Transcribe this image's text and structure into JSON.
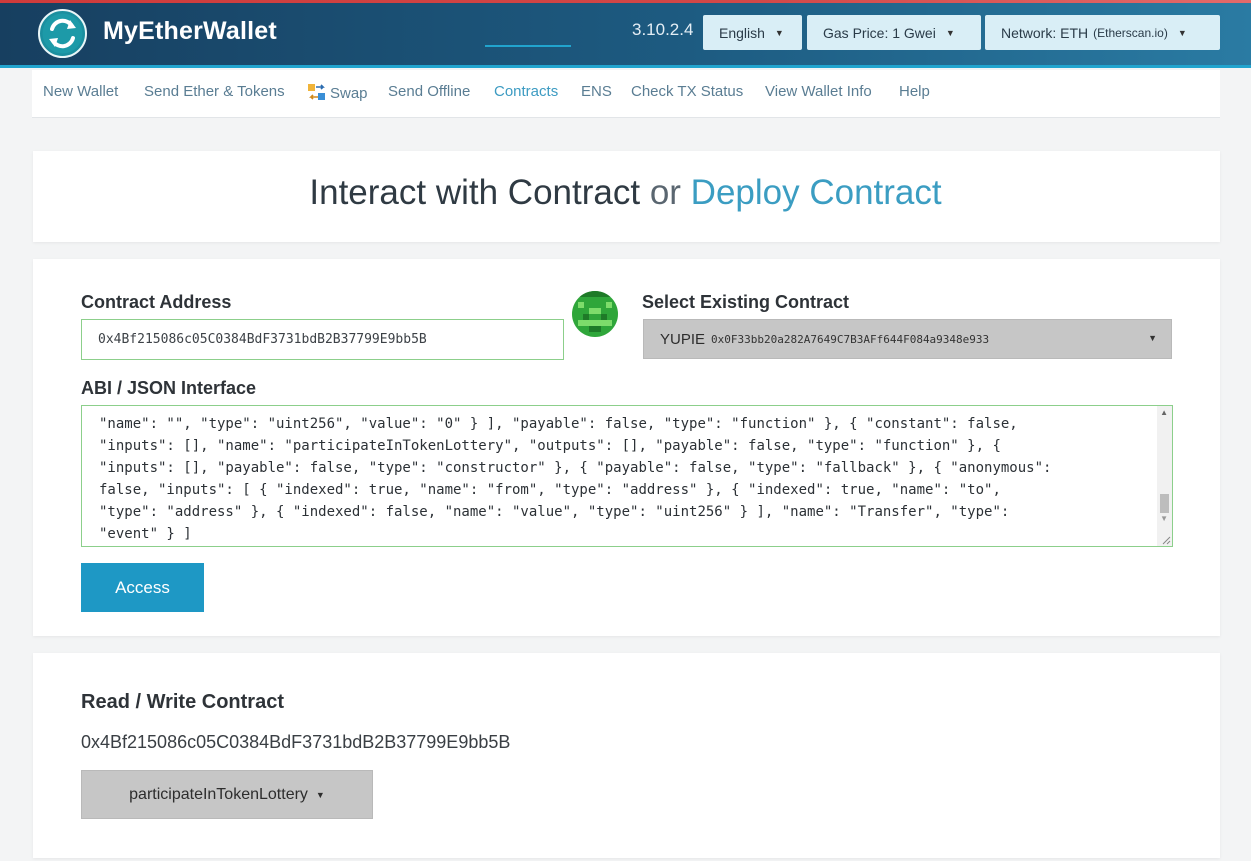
{
  "header": {
    "logo_text": "MyEtherWallet",
    "version": "3.10.2.4",
    "language": "English",
    "gas_price": "Gas Price: 1 Gwei",
    "network_label": "Network: ETH",
    "network_provider": "(Etherscan.io)"
  },
  "nav": {
    "items": [
      {
        "label": "New Wallet"
      },
      {
        "label": "Send Ether & Tokens"
      },
      {
        "label": "Swap"
      },
      {
        "label": "Send Offline"
      },
      {
        "label": "Contracts"
      },
      {
        "label": "ENS"
      },
      {
        "label": "Check TX Status"
      },
      {
        "label": "View Wallet Info"
      },
      {
        "label": "Help"
      }
    ],
    "active": "Contracts"
  },
  "title": {
    "interact": "Interact with Contract",
    "or": "or",
    "deploy": "Deploy Contract"
  },
  "form": {
    "contract_address_label": "Contract Address",
    "contract_address_value": "0x4Bf215086c05C0384BdF3731bdB2B37799E9bb5B",
    "select_label": "Select Existing Contract",
    "selected_name": "YUPIE",
    "selected_address": "0x0F33bb20a282A7649C7B3AFf644F084a9348e933",
    "abi_label": "ABI / JSON Interface",
    "abi_lines": [
      "\"name\": \"\", \"type\": \"uint256\", \"value\": \"0\" } ], \"payable\": false, \"type\": \"function\" }, { \"constant\": false,",
      "\"inputs\": [], \"name\": \"participateInTokenLottery\", \"outputs\": [], \"payable\": false, \"type\": \"function\" }, {",
      "\"inputs\": [], \"payable\": false, \"type\": \"constructor\" }, { \"payable\": false, \"type\": \"fallback\" }, { \"anonymous\":",
      "false, \"inputs\": [ { \"indexed\": true, \"name\": \"from\", \"type\": \"address\" }, { \"indexed\": true, \"name\": \"to\",",
      "\"type\": \"address\" }, { \"indexed\": false, \"name\": \"value\", \"type\": \"uint256\" } ], \"name\": \"Transfer\", \"type\":",
      "\"event\" } ]"
    ],
    "access_label": "Access"
  },
  "read_write": {
    "title": "Read / Write Contract",
    "address": "0x4Bf215086c05C0384BdF3731bdB2B37799E9bb5B",
    "selected_function": "participateInTokenLottery"
  },
  "colors": {
    "accent": "#21a4ce",
    "header_dark": "#173f60",
    "input_border": "#8ccf8b",
    "button_gray": "#c6c6c6"
  }
}
